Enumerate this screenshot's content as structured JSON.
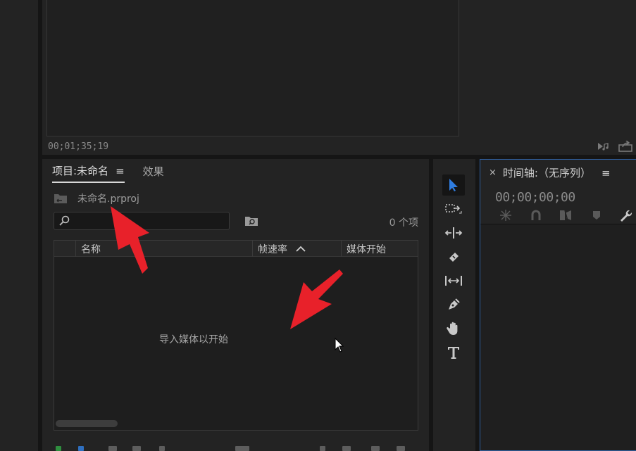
{
  "monitor": {
    "timecode": "00;01;35;19",
    "icons": [
      "audio-output-icon",
      "export-frame-icon"
    ]
  },
  "project": {
    "tab_project": "项目:未命名",
    "tab_effects": "效果",
    "menu_icon": "≡",
    "file_name": "未命名.prproj",
    "search_placeholder": "",
    "item_count": "0 个项",
    "columns": {
      "name": "名称",
      "frame_rate": "帧速率",
      "media_start": "媒体开始"
    },
    "empty_hint": "导入媒体以开始"
  },
  "tools": [
    "selection-tool-icon",
    "track-select-tool-icon",
    "ripple-edit-tool-icon",
    "razor-tool-icon",
    "slip-tool-icon",
    "pen-tool-icon",
    "hand-tool-icon",
    "type-tool-icon"
  ],
  "timeline": {
    "close": "×",
    "title": "时间轴:（无序列）",
    "menu_icon": "≡",
    "timecode": "00;00;00;00"
  },
  "colors": {
    "accent": "#2f7de1",
    "annotation": "#e8212a"
  }
}
